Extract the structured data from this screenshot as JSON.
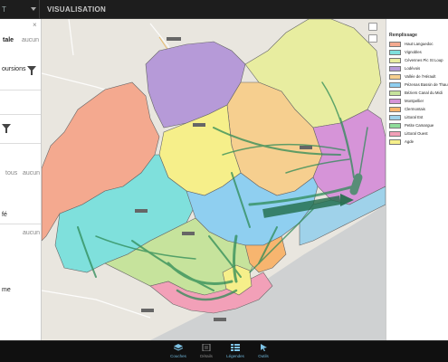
{
  "topbar": {
    "left_tab": "T",
    "title": "VISUALISATION"
  },
  "panel": {
    "close": "×",
    "heading": "tale",
    "lines": [
      "aucun",
      "oursions"
    ],
    "tous": "tous",
    "aucun2": "aucun",
    "fe": "fé",
    "aucun3": "aucun",
    "me": "me"
  },
  "legend": {
    "title": "Remplissage",
    "items": [
      {
        "label": "Haut Languedoc",
        "color": "#f4a98f"
      },
      {
        "label": "Vignobles",
        "color": "#7fe0dc"
      },
      {
        "label": "Cévennes Pic St Loup",
        "color": "#e8eda0"
      },
      {
        "label": "Lodévois",
        "color": "#b69ad8"
      },
      {
        "label": "Vallée de l'Hérault",
        "color": "#f6cf8f"
      },
      {
        "label": "Pézenas Bassin de Thau",
        "color": "#8fcff0"
      },
      {
        "label": "Béziers Canal du Midi",
        "color": "#c6e39c"
      },
      {
        "label": "Montpellier",
        "color": "#d694d8"
      },
      {
        "label": "Clermontais",
        "color": "#f7b56f"
      },
      {
        "label": "Littoral Est",
        "color": "#9fd2ea"
      },
      {
        "label": "Petite Camargue",
        "color": "#8fdc9a"
      },
      {
        "label": "Littoral Ouest",
        "color": "#f2a0b8"
      },
      {
        "label": "Agde",
        "color": "#f6ef8a"
      }
    ]
  },
  "toolbar": {
    "couches": "Couches",
    "details": "Détails",
    "legendes": "Légendes",
    "outils": "Outils"
  }
}
